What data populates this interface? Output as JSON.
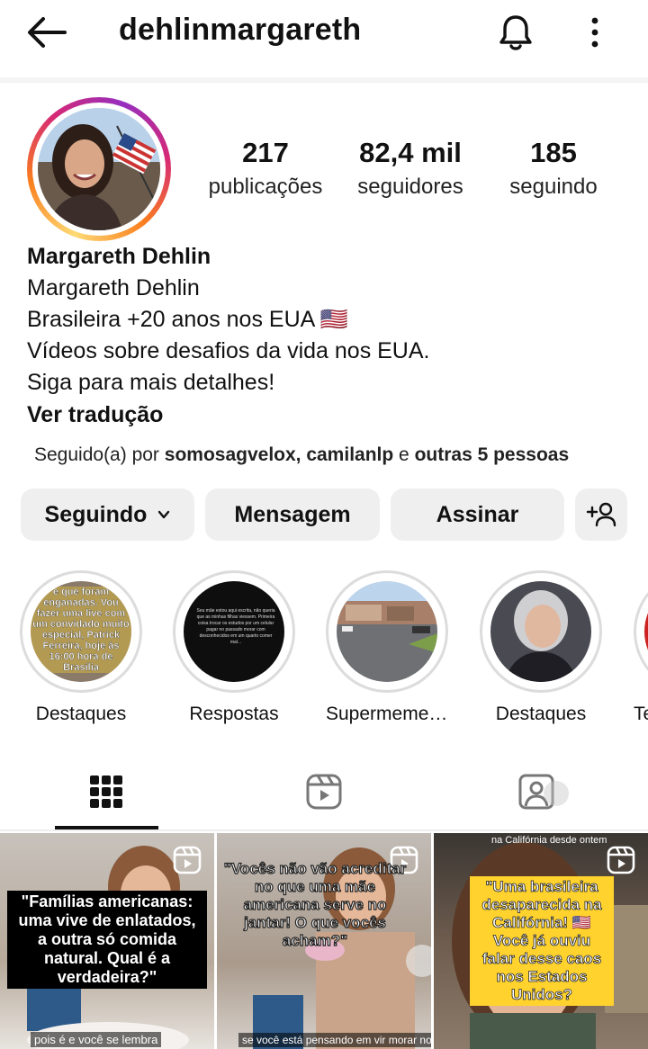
{
  "header": {
    "username": "dehlinmargareth",
    "back_icon": "arrow-left-icon",
    "notification_icon": "bell-icon",
    "menu_icon": "more-vertical-icon"
  },
  "profile": {
    "avatar_icon": "profile-avatar",
    "stats": [
      {
        "value": "217",
        "label": "publicações"
      },
      {
        "value": "82,4 mil",
        "label": "seguidores"
      },
      {
        "value": "185",
        "label": "seguindo"
      }
    ],
    "display_name": "Margareth Dehlin",
    "bio": [
      "Margareth Dehlin",
      "Brasileira +20 anos nos EUA 🇺🇸",
      "Vídeos sobre desafios da vida nos EUA.",
      "Siga para mais detalhes!"
    ],
    "translate_link": "Ver tradução",
    "followed_by": {
      "prefix": "Seguido(a) por ",
      "names": "somosagvelox, camilanlp",
      "middle": " e ",
      "others": "outras 5 pessoas"
    }
  },
  "actions": {
    "following": "Seguindo",
    "message": "Mensagem",
    "subscribe": "Assinar",
    "add_person_icon": "add-person-icon"
  },
  "highlights": [
    {
      "label": "Destaques",
      "overlay": "e que foram enganadas. Vou fazer uma live com um convidado muito especial, Patrick Ferreira, hoje às 16:00 hora de Brasília"
    },
    {
      "label": "Respostas",
      "overlay": "Seu mãe estou aqui escrita, não queria que as minhas filhas viessem. Primeira coisa trocar os estudos por um celular pagar no passado morar com desconhecidos em um quarto comer mal..."
    },
    {
      "label": "Supermemerc...",
      "overlay": ""
    },
    {
      "label": "Destaques",
      "overlay": ""
    },
    {
      "label": "Te",
      "overlay": ""
    }
  ],
  "tabs": [
    {
      "name": "grid",
      "icon": "grid-icon",
      "active": true
    },
    {
      "name": "reels",
      "icon": "reels-icon",
      "active": false
    },
    {
      "name": "tagged",
      "icon": "tagged-person-icon",
      "active": false
    }
  ],
  "posts": [
    {
      "caption": "\"Famílias americanas: uma vive de enlatados, a outra só comida natural. Qual é a verdadeira?\"",
      "subtitle": "pois é e você se lembra",
      "style": "black"
    },
    {
      "caption": "\"Vocês não vão acreditar no que uma mãe americana serve no jantar! O que vocês acham?\"",
      "subtitle": "se você está pensando em vir morar nos Estados",
      "style": "outline"
    },
    {
      "top_label": "na Califórnia desde ontem",
      "caption": "\"Uma brasileira desaparecida na Califórnia! 🇺🇸 Você já ouviu falar desse caos nos Estados Unidos?",
      "style": "yellow"
    }
  ],
  "colors": {
    "button_bg": "#efefef",
    "text": "#111111",
    "story_ring_gradient": [
      "#feda75",
      "#fa7e1e",
      "#d62976",
      "#962fbf"
    ]
  }
}
